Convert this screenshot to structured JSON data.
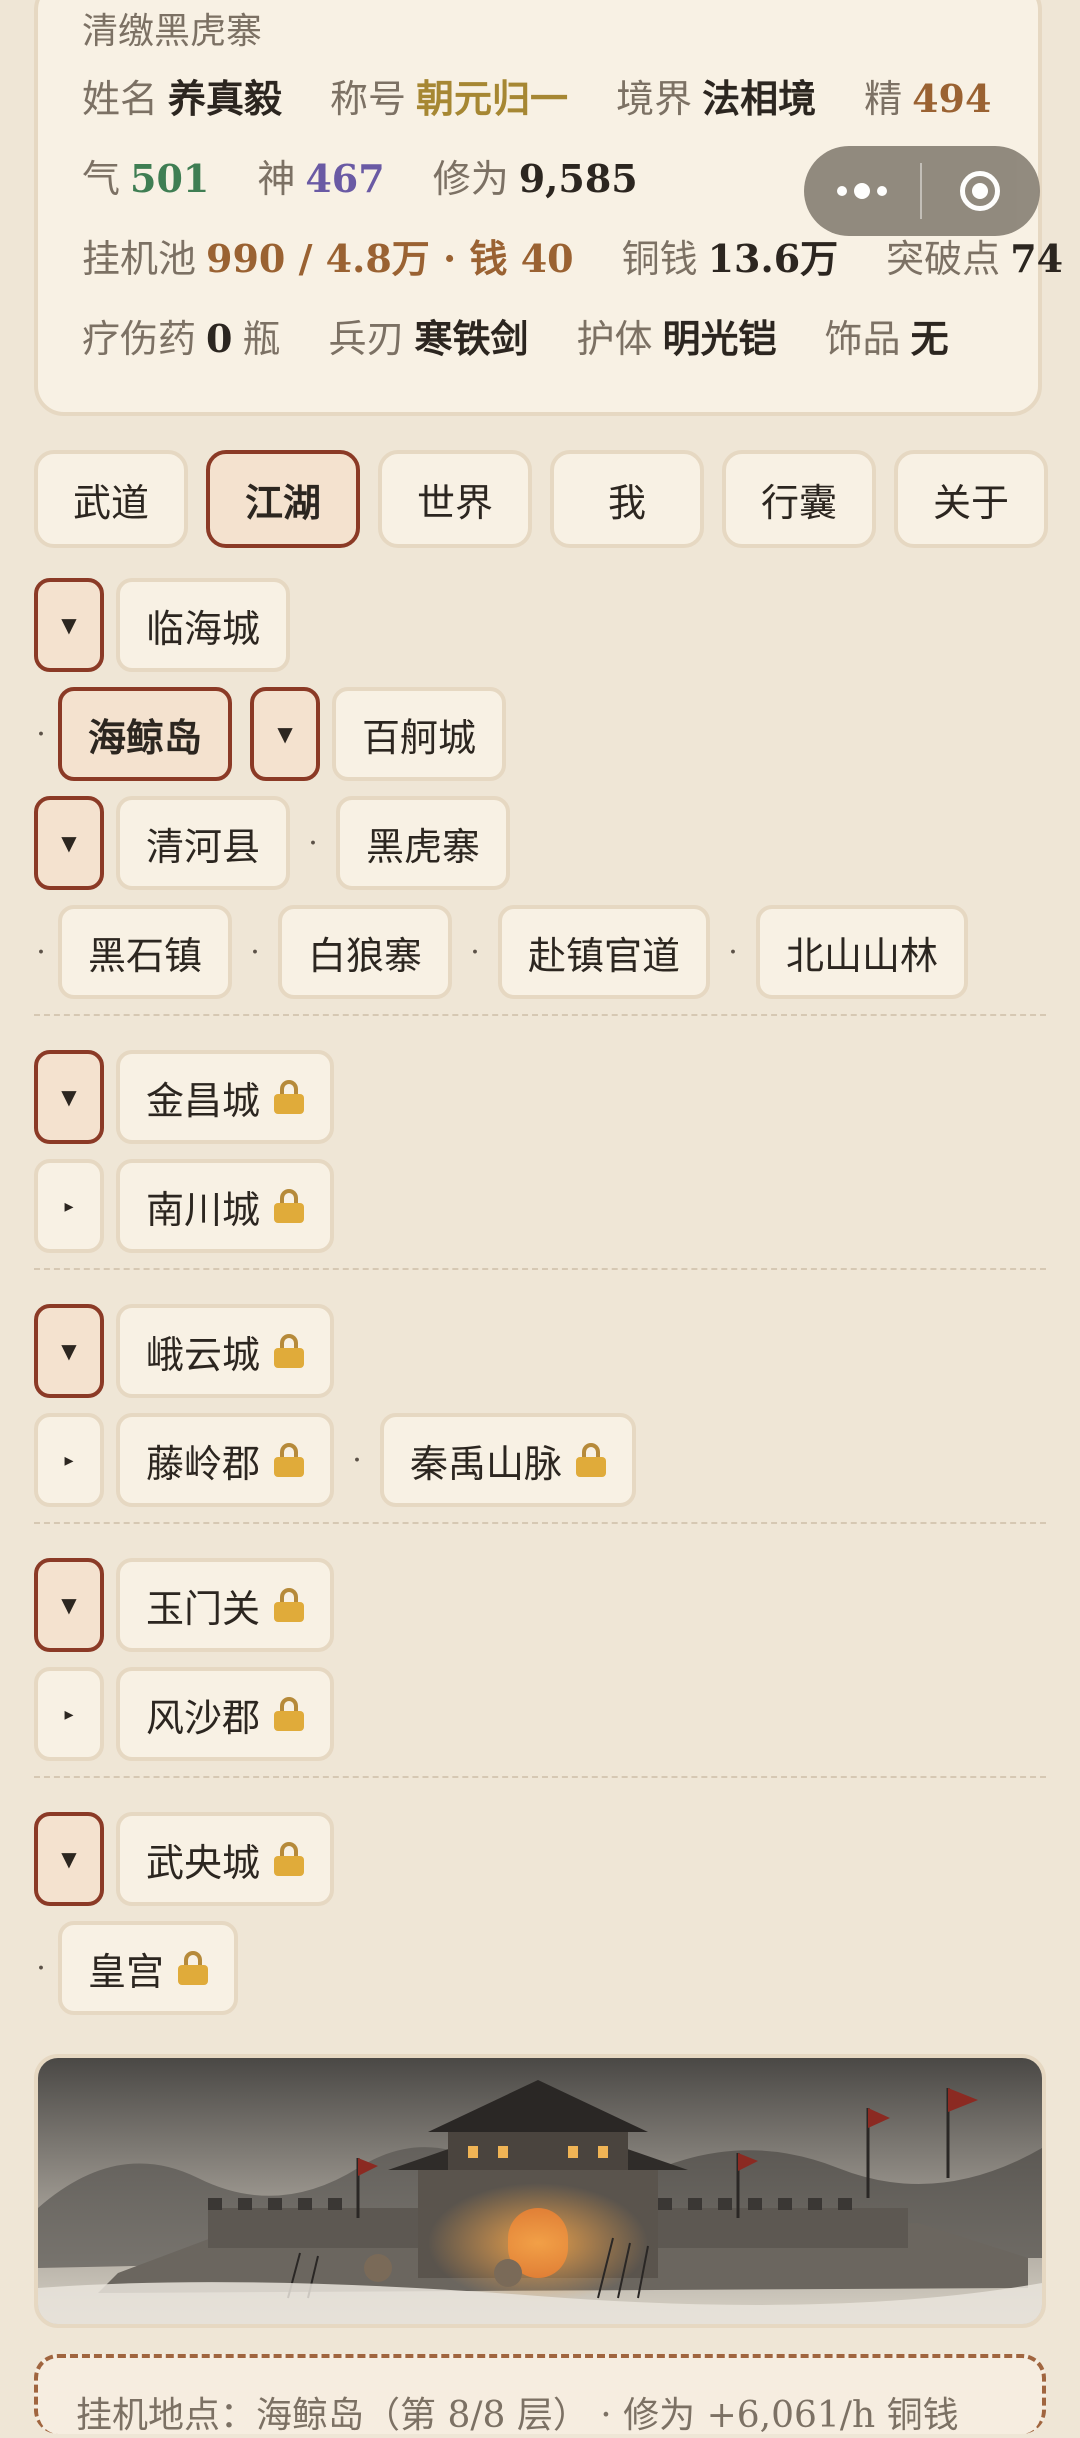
{
  "status": {
    "subtitle": "清缴黑虎寨",
    "name_label": "姓名",
    "name": "养真毅",
    "title_label": "称号",
    "title": "朝元归一",
    "realm_label": "境界",
    "realm": "法相境",
    "jing_label": "精",
    "jing": "494",
    "qi_label": "气",
    "qi": "501",
    "shen_label": "神",
    "shen": "467",
    "xiuwei_label": "修为",
    "xiuwei": "9,585",
    "pool_label": "挂机池",
    "pool": "990 / 4.8万 · 钱 40",
    "coins_label": "铜钱",
    "coins": "13.6万",
    "breakthrough_label": "突破点",
    "breakthrough": "74",
    "potion_label": "疗伤药",
    "potion_count": "0",
    "potion_unit": "瓶",
    "weapon_label": "兵刃",
    "weapon": "寒铁剑",
    "armor_label": "护体",
    "armor": "明光铠",
    "ornament_label": "饰品",
    "ornament": "无"
  },
  "tabs": [
    "武道",
    "江湖",
    "世界",
    "我",
    "行囊",
    "关于"
  ],
  "active_tab": "江湖",
  "map": {
    "linhai": "临海城",
    "haijing": "海鲸岛",
    "baige": "百舸城",
    "qinghe": "清河县",
    "heihu": "黑虎寨",
    "heishi": "黑石镇",
    "bailang": "白狼寨",
    "fuzhen": "赴镇官道",
    "beishan": "北山山林",
    "jinchang": "金昌城",
    "nanchuan": "南川城",
    "eyun": "峨云城",
    "tengling": "藤岭郡",
    "qinyu": "秦禹山脉",
    "yumen": "玉门关",
    "fengsha": "风沙郡",
    "wuyang": "武央城",
    "huanggong": "皇宫"
  },
  "toggle_icons": {
    "expanded": "▼",
    "collapsed": "▸"
  },
  "lock_icon": "lock-icon",
  "footer": {
    "text": "挂机地点：海鲸岛（第 8/8 层） · 修为 +6,061/h 铜钱"
  }
}
